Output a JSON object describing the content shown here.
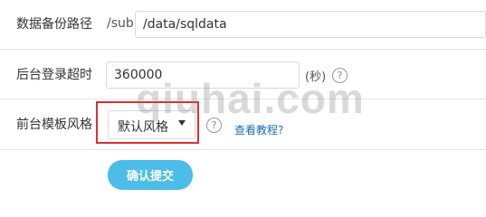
{
  "backup_path": {
    "label": "数据备份路径",
    "prefix": "/sub",
    "value": "/data/sqldata"
  },
  "login_timeout": {
    "label": "后台登录超时",
    "value": "360000",
    "unit": "(秒)",
    "help_icon": "?"
  },
  "template_style": {
    "label": "前台模板风格",
    "selected": "默认风格",
    "help_icon": "?",
    "tutorial_link": "查看教程?"
  },
  "submit_label": "确认提交",
  "watermark_text": "qiuhai.com",
  "colors": {
    "highlight": "#d9312f",
    "submit_bg": "#4bbde8",
    "link": "#1a6eb5"
  }
}
